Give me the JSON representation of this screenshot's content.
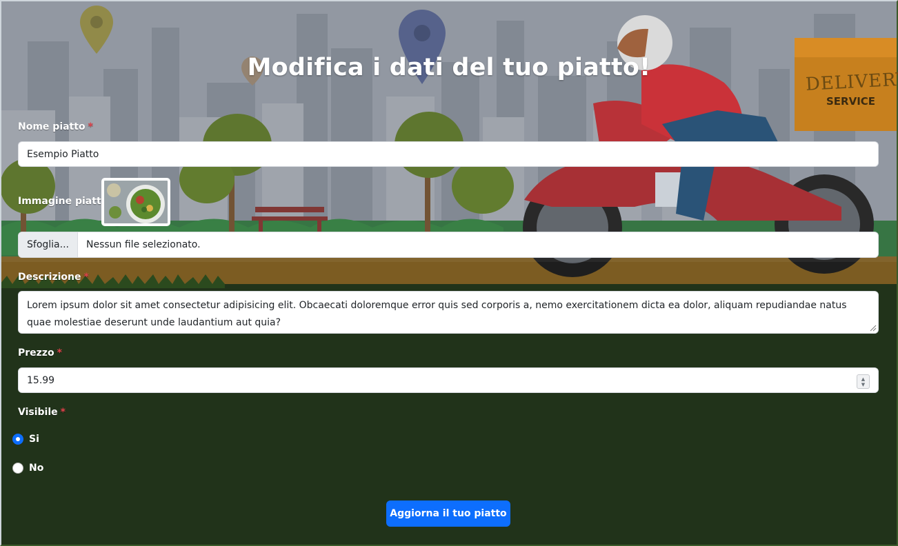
{
  "page": {
    "title": "Modifica i dati del tuo piatto!",
    "required_marker": "*"
  },
  "background": {
    "delivery_box_text": "DELIVERY",
    "delivery_box_subtext": "SERVICE"
  },
  "form": {
    "name": {
      "label": "Nome piatto",
      "value": "Esempio Piatto"
    },
    "image": {
      "label": "Immagine piatto",
      "browse_label": "Sfoglia...",
      "file_status": "Nessun file selezionato."
    },
    "description": {
      "label": "Descrizione",
      "value": "Lorem ipsum dolor sit amet consectetur adipisicing elit. Obcaecati doloremque error quis sed corporis a, nemo exercitationem dicta ea dolor, aliquam repudiandae natus quae molestiae deserunt unde laudantium aut quia?"
    },
    "price": {
      "label": "Prezzo",
      "value": "15.99"
    },
    "visible": {
      "label": "Visibile",
      "options": [
        {
          "label": "Si",
          "checked": true
        },
        {
          "label": "No",
          "checked": false
        }
      ]
    },
    "submit_label": "Aggiorna il tuo piatto"
  },
  "colors": {
    "accent": "#0d6efd",
    "required": "#e0434b",
    "ground": "#21331a"
  }
}
